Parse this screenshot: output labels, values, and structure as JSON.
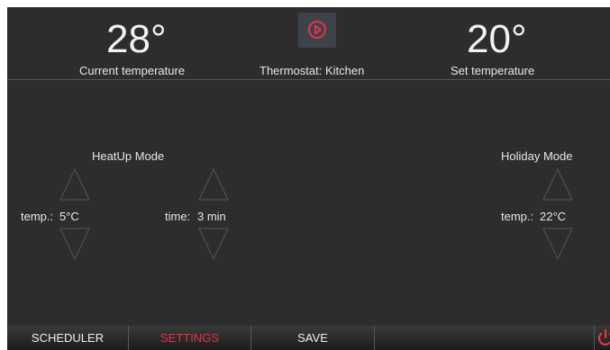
{
  "header": {
    "current_temp": "28°",
    "current_label": "Current temperature",
    "thermostat_label": "Thermostat: Kitchen",
    "set_temp": "20°",
    "set_label": "Set temperature",
    "play_icon": "play-circle-icon"
  },
  "heatup": {
    "title": "HeatUp Mode",
    "temp_label": "temp.:",
    "temp_value": "5°C",
    "time_label": "time:",
    "time_value": "3 min"
  },
  "holiday": {
    "title": "Holiday Mode",
    "temp_label": "temp.:",
    "temp_value": "22°C"
  },
  "bottom_bar": {
    "tabs": [
      {
        "label": "SCHEDULER",
        "color": "#f0f0f0"
      },
      {
        "label": "SETTINGS",
        "color": "#e8324a",
        "active": true
      },
      {
        "label": "SAVE",
        "color": "#f0f0f0"
      }
    ],
    "power_icon": "power-icon"
  },
  "colors": {
    "accent": "#e8324a",
    "background": "#2d2d2d",
    "text": "#e9e9e9"
  }
}
